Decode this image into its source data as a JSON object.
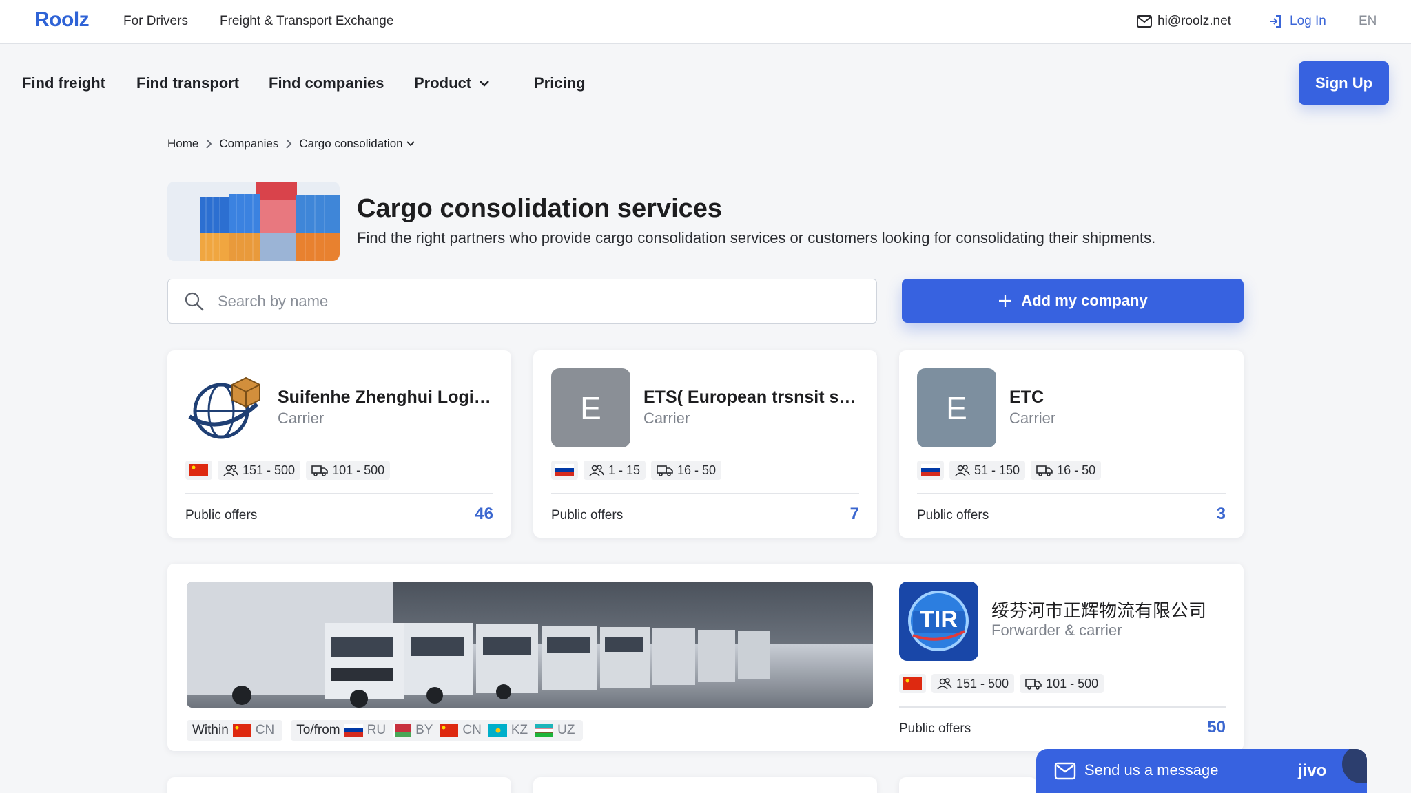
{
  "topbar": {
    "logo": "Roolz",
    "links": [
      "For Drivers",
      "Freight & Transport Exchange"
    ],
    "email": "hi@roolz.net",
    "login": "Log In",
    "lang": "EN"
  },
  "nav": {
    "items": [
      "Find freight",
      "Find transport",
      "Find companies",
      "Product",
      "Pricing"
    ],
    "signup": "Sign Up"
  },
  "breadcrumb": [
    "Home",
    "Companies",
    "Cargo consolidation"
  ],
  "header": {
    "title": "Cargo consolidation services",
    "subtitle": "Find the right partners who provide cargo consolidation services or customers looking for consolidating their shipments."
  },
  "search": {
    "placeholder": "Search by name"
  },
  "add_button": "Add my company",
  "cards": [
    {
      "name": "Suifenhe Zhenghui Logist...",
      "role": "Carrier",
      "country": "CN",
      "employees": "151 - 500",
      "fleet": "101 - 500",
      "offers_label": "Public offers",
      "offers": "46",
      "avatar": "globe-box"
    },
    {
      "name": "ETS( European trsnsit ser...",
      "role": "Carrier",
      "country": "RU",
      "employees": "1 - 15",
      "fleet": "16 - 50",
      "offers_label": "Public offers",
      "offers": "7",
      "avatar_letter": "E"
    },
    {
      "name": "ETC",
      "role": "Carrier",
      "country": "RU",
      "employees": "51 - 150",
      "fleet": "16 - 50",
      "offers_label": "Public offers",
      "offers": "3",
      "avatar_letter": "E"
    }
  ],
  "featured": {
    "name": "绥芬河市正辉物流有限公司",
    "role": "Forwarder & carrier",
    "avatar_text": "TIR",
    "country": "CN",
    "employees": "151 - 500",
    "fleet": "101 - 500",
    "offers_label": "Public offers",
    "offers": "50",
    "within_label": "Within",
    "within": [
      "CN"
    ],
    "tofrom_label": "To/from",
    "tofrom": [
      "RU",
      "BY",
      "CN",
      "KZ",
      "UZ"
    ]
  },
  "chat": {
    "label": "Send us a message",
    "brand": "jivo"
  },
  "colors": {
    "accent": "#3762e0",
    "link": "#3b66d8",
    "offers": "#3a66cf"
  }
}
